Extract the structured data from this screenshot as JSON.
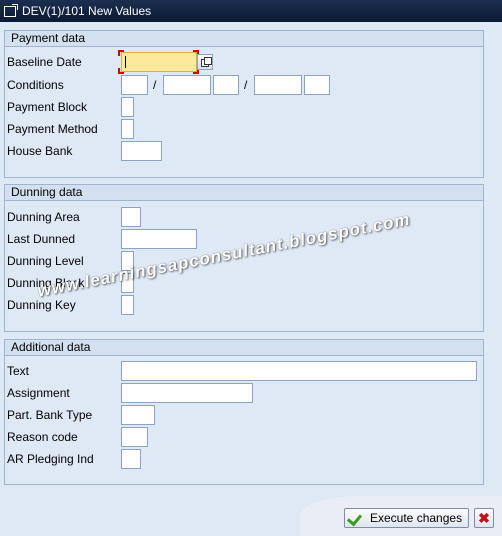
{
  "window": {
    "title": "DEV(1)/101 New Values"
  },
  "payment": {
    "title": "Payment data",
    "baseline_date": "Baseline Date",
    "conditions": "Conditions",
    "cond_sep1": "/",
    "cond_sep2": "/",
    "payment_block": "Payment Block",
    "payment_method": "Payment Method",
    "house_bank": "House Bank"
  },
  "dunning": {
    "title": "Dunning data",
    "dunning_area": "Dunning Area",
    "last_dunned": "Last Dunned",
    "dunning_level": "Dunning Level",
    "dunning_block": "Dunning Block",
    "dunning_key": "Dunning Key"
  },
  "additional": {
    "title": "Additional data",
    "text": "Text",
    "assignment": "Assignment",
    "part_bank_type": "Part. Bank Type",
    "reason_code": "Reason code",
    "ar_pledging": "AR Pledging Ind"
  },
  "watermark": "www.learningsapconsultant.blogspot.com",
  "footer": {
    "execute_label": "Execute changes",
    "cancel_glyph": "✖"
  },
  "colors": {
    "accent_yellow": "#fde99c",
    "selection": "#d40000",
    "check": "#3a9b1f",
    "cancel": "#c0111a"
  },
  "icons": [
    "window-icon",
    "possible-entries-icon",
    "check-icon",
    "cancel-icon"
  ]
}
